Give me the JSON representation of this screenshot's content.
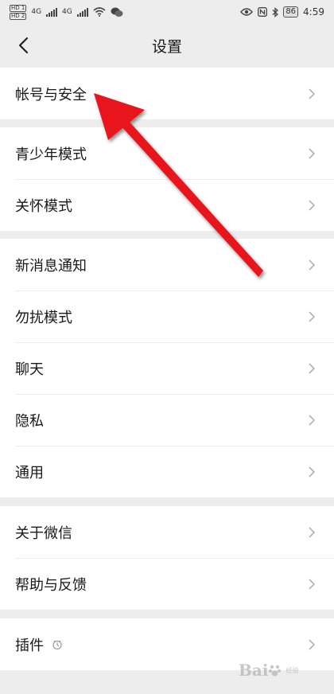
{
  "status_bar": {
    "network_left_1": "4G",
    "network_left_2": "4G",
    "battery": "86",
    "time": "4:59"
  },
  "nav": {
    "title": "设置"
  },
  "groups": [
    {
      "items": [
        {
          "label": "帐号与安全"
        }
      ]
    },
    {
      "items": [
        {
          "label": "青少年模式"
        },
        {
          "label": "关怀模式"
        }
      ]
    },
    {
      "items": [
        {
          "label": "新消息通知"
        },
        {
          "label": "勿扰模式"
        },
        {
          "label": "聊天"
        },
        {
          "label": "隐私"
        },
        {
          "label": "通用"
        }
      ]
    },
    {
      "items": [
        {
          "label": "关于微信"
        },
        {
          "label": "帮助与反馈"
        }
      ]
    },
    {
      "items": [
        {
          "label": "插件"
        }
      ]
    }
  ],
  "annotation": {
    "color": "#e8141b",
    "target": "帐号与安全"
  },
  "watermark": {
    "text": "Bai",
    "sub": "经验"
  },
  "colors": {
    "background": "#ededed",
    "row_background": "#ffffff",
    "chevron": "#b2b2b2"
  }
}
